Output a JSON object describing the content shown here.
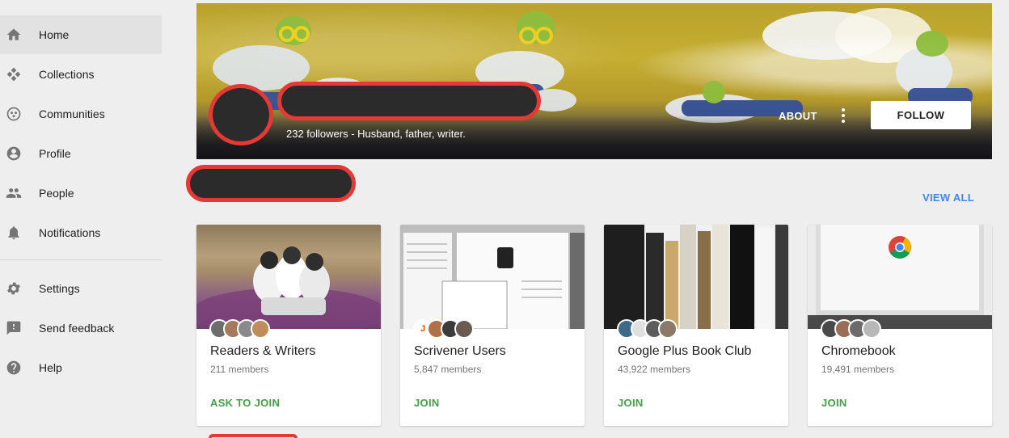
{
  "sidebar": {
    "items": [
      {
        "label": "Home",
        "icon": "home-icon",
        "active": true
      },
      {
        "label": "Collections",
        "icon": "collections-icon"
      },
      {
        "label": "Communities",
        "icon": "communities-icon"
      },
      {
        "label": "Profile",
        "icon": "profile-icon"
      },
      {
        "label": "People",
        "icon": "people-icon"
      },
      {
        "label": "Notifications",
        "icon": "notifications-icon"
      },
      {
        "label": "Settings",
        "icon": "settings-icon"
      },
      {
        "label": "Send feedback",
        "icon": "feedback-icon"
      },
      {
        "label": "Help",
        "icon": "help-icon"
      }
    ]
  },
  "profile": {
    "subtitle": "232 followers - Husband, father, writer.",
    "about_label": "ABOUT",
    "follow_label": "FOLLOW"
  },
  "communities": {
    "view_all_label": "VIEW ALL",
    "cards": [
      {
        "title": "Readers & Writers",
        "members": "211 members",
        "action": "ASK TO JOIN"
      },
      {
        "title": "Scrivener Users",
        "members": "5,847 members",
        "action": "JOIN",
        "avatar_letter": "J"
      },
      {
        "title": "Google Plus Book Club",
        "members": "43,922 members",
        "action": "JOIN"
      },
      {
        "title": "Chromebook",
        "members": "19,491 members",
        "action": "JOIN"
      }
    ]
  },
  "colors": {
    "redaction_outline": "#e53935",
    "join_green": "#43a047",
    "link_blue": "#4285f4"
  }
}
